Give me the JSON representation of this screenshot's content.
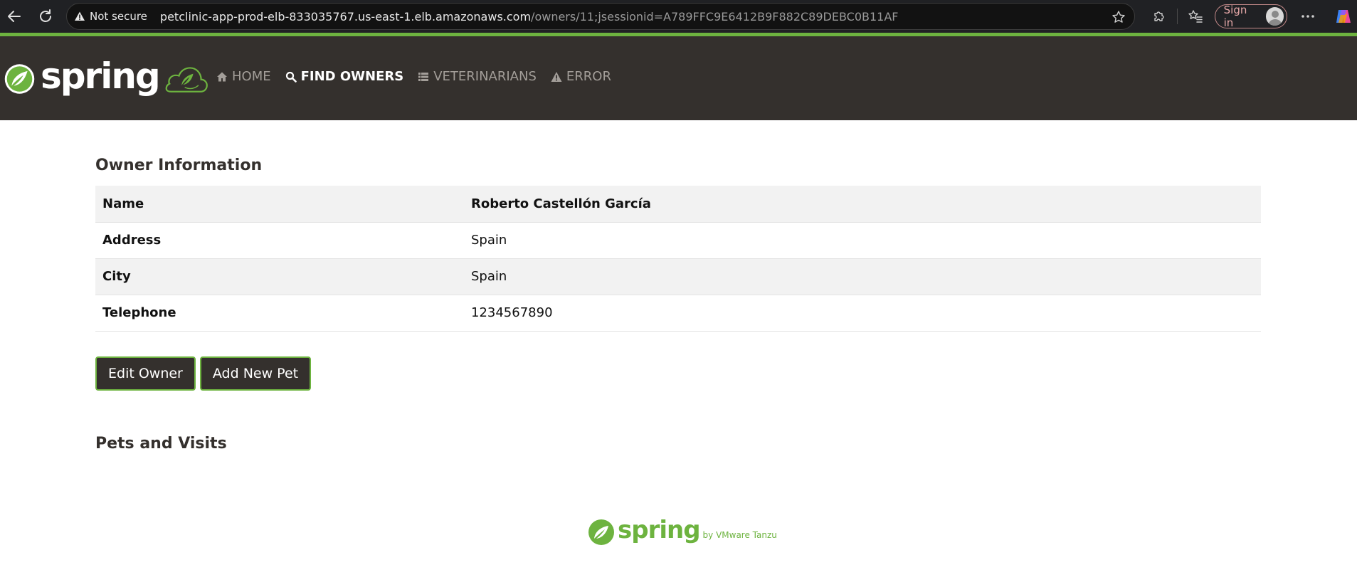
{
  "browser": {
    "security_label": "Not secure",
    "url_host": "petclinic-app-prod-elb-833035767.us-east-1.elb.amazonaws.com",
    "url_path": "/owners/11;jsessionid=A789FFC9E6412B9F882C89DEBC0B11AF",
    "signin_label": "Sign in"
  },
  "brand": {
    "wordmark": "spring"
  },
  "nav": {
    "items": [
      {
        "label": "Home",
        "icon": "home-icon",
        "active": false
      },
      {
        "label": "Find owners",
        "icon": "search-icon",
        "active": true
      },
      {
        "label": "Veterinarians",
        "icon": "list-icon",
        "active": false
      },
      {
        "label": "Error",
        "icon": "warning-icon",
        "active": false
      }
    ]
  },
  "owner": {
    "heading": "Owner Information",
    "rows": [
      {
        "label": "Name",
        "value": "Roberto Castellón García"
      },
      {
        "label": "Address",
        "value": "Spain"
      },
      {
        "label": "City",
        "value": "Spain"
      },
      {
        "label": "Telephone",
        "value": "1234567890"
      }
    ]
  },
  "actions": {
    "edit_label": "Edit Owner",
    "add_pet_label": "Add New Pet"
  },
  "pets": {
    "heading": "Pets and Visits"
  },
  "footer": {
    "wordmark": "spring",
    "byline": "by VMware Tanzu"
  },
  "colors": {
    "brand_green": "#6db33f",
    "navbar_bg": "#34302d"
  }
}
